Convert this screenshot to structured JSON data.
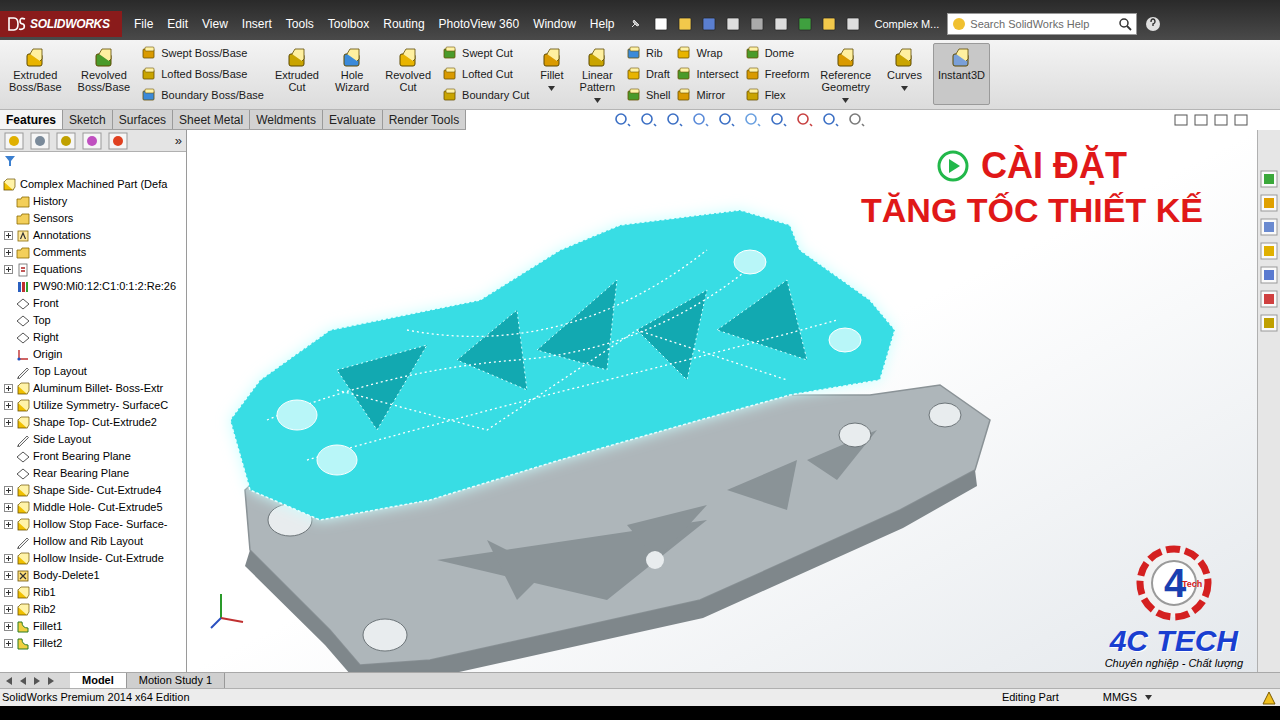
{
  "app": {
    "logo": "SOLIDWORKS",
    "document_title": "Complex M...",
    "menu": [
      "File",
      "Edit",
      "View",
      "Insert",
      "Tools",
      "Toolbox",
      "Routing",
      "PhotoView 360",
      "Window",
      "Help"
    ],
    "search": {
      "placeholder": "Search SolidWorks Help"
    }
  },
  "ribbon": [
    {
      "kind": "large",
      "lines": [
        "Extruded",
        "Boss/Base"
      ],
      "dropdown": false,
      "selected": false
    },
    {
      "kind": "large",
      "lines": [
        "Revolved",
        "Boss/Base"
      ],
      "dropdown": false,
      "selected": false
    },
    {
      "kind": "stack",
      "labels": [
        "Swept Boss/Base",
        "Lofted Boss/Base",
        "Boundary Boss/Base"
      ]
    },
    {
      "kind": "large",
      "lines": [
        "Extruded",
        "Cut"
      ],
      "dropdown": false,
      "selected": false
    },
    {
      "kind": "large",
      "lines": [
        "Hole",
        "Wizard"
      ],
      "dropdown": false,
      "selected": false
    },
    {
      "kind": "large",
      "lines": [
        "Revolved",
        "Cut"
      ],
      "dropdown": false,
      "selected": false
    },
    {
      "kind": "stack",
      "labels": [
        "Swept Cut",
        "Lofted Cut",
        "Boundary Cut"
      ]
    },
    {
      "kind": "large",
      "lines": [
        "Fillet"
      ],
      "dropdown": true,
      "selected": false
    },
    {
      "kind": "large",
      "lines": [
        "Linear",
        "Pattern"
      ],
      "dropdown": true,
      "selected": false
    },
    {
      "kind": "stack",
      "labels": [
        "Rib",
        "Draft",
        "Shell"
      ]
    },
    {
      "kind": "stack",
      "labels": [
        "Wrap",
        "Intersect",
        "Mirror"
      ]
    },
    {
      "kind": "stack",
      "labels": [
        "Dome",
        "Freeform",
        "Flex"
      ]
    },
    {
      "kind": "large",
      "lines": [
        "Reference",
        "Geometry"
      ],
      "dropdown": true,
      "selected": false
    },
    {
      "kind": "large",
      "lines": [
        "Curves"
      ],
      "dropdown": true,
      "selected": false
    },
    {
      "kind": "large",
      "lines": [
        "Instant3D"
      ],
      "dropdown": false,
      "selected": true
    }
  ],
  "tabs": [
    {
      "label": "Features",
      "selected": true
    },
    {
      "label": "Sketch",
      "selected": false
    },
    {
      "label": "Surfaces",
      "selected": false
    },
    {
      "label": "Sheet Metal",
      "selected": false
    },
    {
      "label": "Weldments",
      "selected": false
    },
    {
      "label": "Evaluate",
      "selected": false
    },
    {
      "label": "Render Tools",
      "selected": false
    }
  ],
  "panel": {
    "expand_glyph": "»"
  },
  "tree": {
    "root": "Complex Machined Part  (Defa",
    "items": [
      {
        "label": "History",
        "kind": "folder",
        "expandable": false
      },
      {
        "label": "Sensors",
        "kind": "folder",
        "expandable": false
      },
      {
        "label": "Annotations",
        "kind": "note",
        "expandable": true
      },
      {
        "label": "Comments",
        "kind": "folder",
        "expandable": true
      },
      {
        "label": "Equations",
        "kind": "equation",
        "expandable": true
      },
      {
        "label": "PW90:Mi0:12:C1:0:1:2:Re:26",
        "kind": "material",
        "expandable": false
      },
      {
        "label": "Front",
        "kind": "plane",
        "expandable": false
      },
      {
        "label": "Top",
        "kind": "plane",
        "expandable": false
      },
      {
        "label": "Right",
        "kind": "plane",
        "expandable": false
      },
      {
        "label": "Origin",
        "kind": "origin",
        "expandable": false
      },
      {
        "label": "Top Layout",
        "kind": "sketch",
        "expandable": false
      },
      {
        "label": "Aluminum Billet- Boss-Extr",
        "kind": "feature",
        "expandable": true
      },
      {
        "label": "Utilize Symmetry- SurfaceC",
        "kind": "feature",
        "expandable": true
      },
      {
        "label": "Shape Top- Cut-Extrude2",
        "kind": "feature",
        "expandable": true
      },
      {
        "label": "Side Layout",
        "kind": "sketch",
        "expandable": false
      },
      {
        "label": "Front Bearing Plane",
        "kind": "plane",
        "expandable": false
      },
      {
        "label": "Rear Bearing Plane",
        "kind": "plane",
        "expandable": false
      },
      {
        "label": "Shape Side- Cut-Extrude4",
        "kind": "feature",
        "expandable": true
      },
      {
        "label": "Middle Hole- Cut-Extrude5",
        "kind": "feature",
        "expandable": true
      },
      {
        "label": "Hollow Stop Face- Surface-",
        "kind": "feature",
        "expandable": true
      },
      {
        "label": "Hollow and Rib Layout",
        "kind": "sketch",
        "expandable": false
      },
      {
        "label": "Hollow Inside- Cut-Extrude",
        "kind": "feature",
        "expandable": true
      },
      {
        "label": "Body-Delete1",
        "kind": "delete",
        "expandable": true
      },
      {
        "label": "Rib1",
        "kind": "feature",
        "expandable": true
      },
      {
        "label": "Rib2",
        "kind": "feature",
        "expandable": true
      },
      {
        "label": "Fillet1",
        "kind": "fillet",
        "expandable": true
      },
      {
        "label": "Fillet2",
        "kind": "fillet",
        "expandable": true
      }
    ]
  },
  "overlay": {
    "lines": [
      "CÀI ĐẶT",
      "TĂNG TỐC THIẾT KẾ"
    ]
  },
  "brand": {
    "name": "4C TECH",
    "slogan": "Chuyên nghiệp - Chất lượng",
    "mark": "4",
    "mark_sub": "Tech"
  },
  "bottom_tabs": [
    {
      "label": "Model",
      "selected": true
    },
    {
      "label": "Motion Study 1",
      "selected": false
    }
  ],
  "status_bar": {
    "edition": "SolidWorks Premium 2014 x64 Edition",
    "mode": "Editing Part",
    "units": "MMGS"
  }
}
